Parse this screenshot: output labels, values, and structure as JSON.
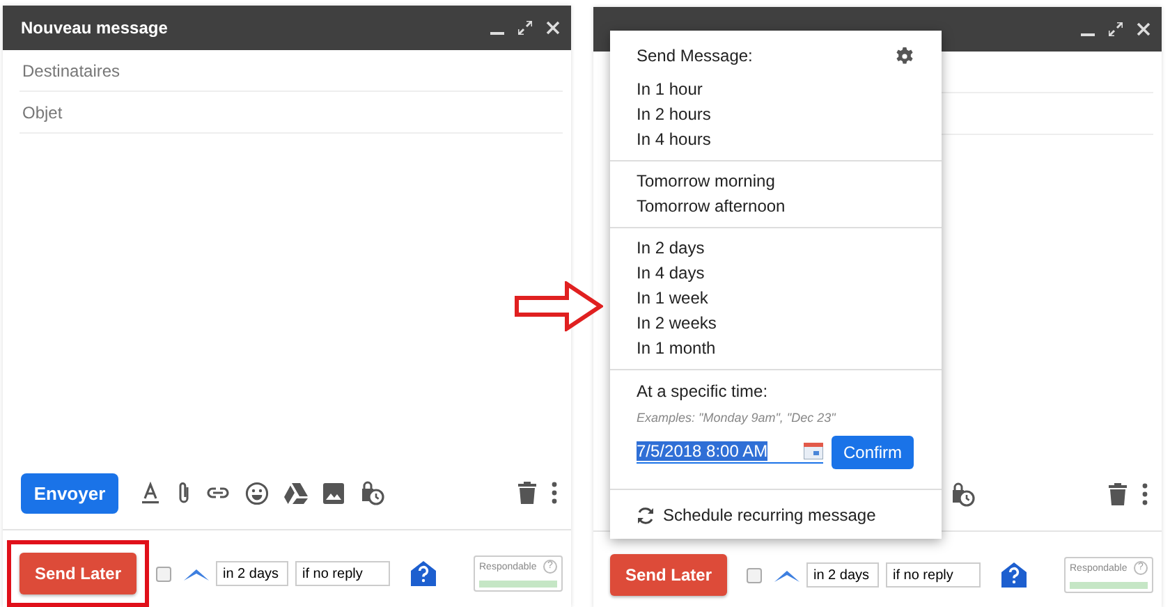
{
  "compose_windows": [
    {
      "title": "Nouveau message",
      "recipients_placeholder": "Destinataires",
      "subject_placeholder": "Objet",
      "send_button": "Envoyer",
      "send_later_button": "Send Later",
      "highlighted": true,
      "followup_checked": false,
      "delay_value": "in 2 days",
      "condition_value": "if no reply",
      "respondable_label": "Respondable",
      "respondable_help": "?"
    },
    {
      "send_later_button": "Send Later",
      "highlighted": false,
      "followup_checked": false,
      "delay_value": "in 2 days",
      "condition_value": "if no reply",
      "respondable_label": "Respondable",
      "respondable_help": "?",
      "send_menu": {
        "title": "Send Message:",
        "groups": [
          [
            "In 1 hour",
            "In 2 hours",
            "In 4 hours"
          ],
          [
            "Tomorrow morning",
            "Tomorrow afternoon"
          ],
          [
            "In 2 days",
            "In 4 days",
            "In 1 week",
            "In 2 weeks",
            "In 1 month"
          ]
        ],
        "specific_label": "At a specific time:",
        "specific_hint": "Examples: \"Monday 9am\", \"Dec 23\"",
        "specific_value": "7/5/2018 8:00 AM",
        "value_selected": true,
        "confirm_button": "Confirm",
        "recurring_link": "Schedule recurring message"
      }
    }
  ]
}
